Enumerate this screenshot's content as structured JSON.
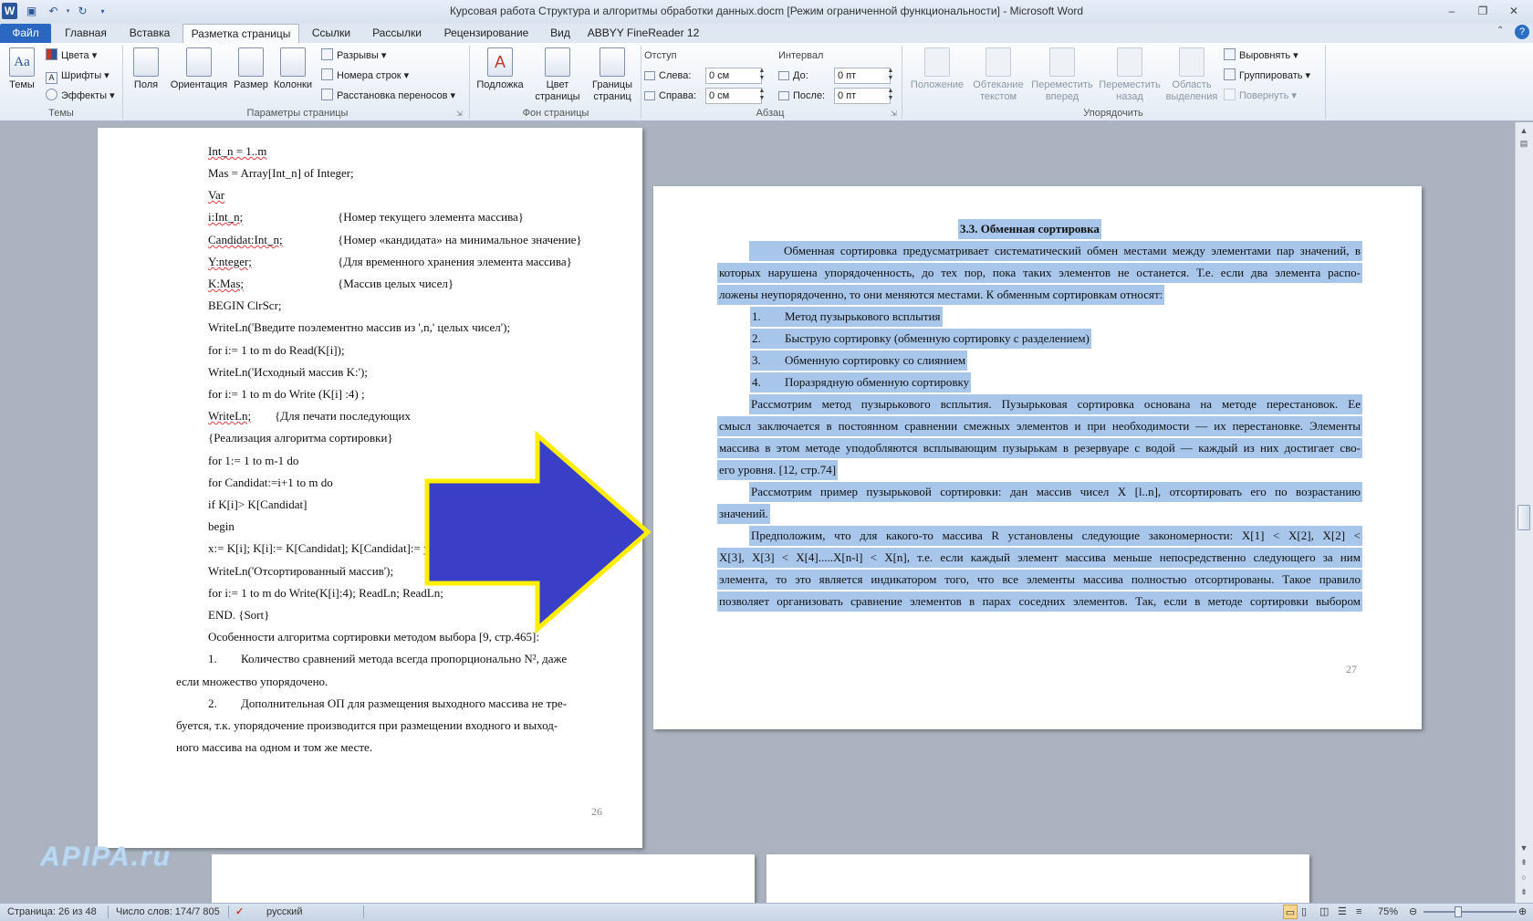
{
  "window": {
    "title": "Курсовая работа Структура и алгоритмы обработки данных.docm [Режим ограниченной функциональности] - Microsoft Word"
  },
  "tabs": [
    "Файл",
    "Главная",
    "Вставка",
    "Разметка страницы",
    "Ссылки",
    "Рассылки",
    "Рецензирование",
    "Вид",
    "ABBYY FineReader 12"
  ],
  "ribbon": {
    "themes": {
      "label": "Темы",
      "big": "Темы",
      "colors": "Цвета",
      "fonts": "Шрифты",
      "effects": "Эффекты"
    },
    "page_setup": {
      "label": "Параметры страницы",
      "fields": "Поля",
      "orientation": "Ориентация",
      "size": "Размер",
      "columns": "Колонки",
      "breaks": "Разрывы",
      "line_numbers": "Номера строк",
      "hyphenation": "Расстановка переносов"
    },
    "page_background": {
      "label": "Фон страницы",
      "watermark": "Подложка",
      "color_l1": "Цвет",
      "color_l2": "страницы",
      "borders_l1": "Границы",
      "borders_l2": "страниц"
    },
    "paragraph": {
      "label": "Абзац",
      "indent_title": "Отступ",
      "left_label": "Слева:",
      "left_value": "0 см",
      "right_label": "Справа:",
      "right_value": "0 см",
      "spacing_title": "Интервал",
      "before_label": "До:",
      "before_value": "0 пт",
      "after_label": "После:",
      "after_value": "0 пт"
    },
    "arrange": {
      "label": "Упорядочить",
      "position": "Положение",
      "wrap_l1": "Обтекание",
      "wrap_l2": "текстом",
      "forward_l1": "Переместить",
      "forward_l2": "вперед",
      "backward_l1": "Переместить",
      "backward_l2": "назад",
      "selection_l1": "Область",
      "selection_l2": "выделения",
      "align": "Выровнять",
      "group": "Группировать",
      "rotate": "Повернуть"
    }
  },
  "page26": {
    "lines": [
      "Int_n =   1..m",
      "Mas = Array[Int_n] of Integer;",
      "Var",
      "i:Int_n;",
      "{Номер текущего элемента массива}",
      "Candidat:Int_n;",
      "{Номер «кандидата» на минимальное значение}",
      "Y:nteger;",
      "{Для временного хранения элемента массива}",
      "K:Mas;",
      "{Массив целых чисел}",
      "BEGIN ClrScr;",
      "WriteLn('Введите поэлементно массив из ',n,' целых чисел');",
      "for i:= 1 to m do Read(K[i]);",
      "WriteLn('Исходный   массив   K:');",
      "for    i:=   1    to    m    do   Write (K[i] :4) ;",
      "WriteLn;",
      "{Для печати последующих",
      "{Реализация алгоритма сортировки}",
      "for 1:= 1 to m-1 do",
      "for Candidat:=i+1 to m do",
      "if K[i]> K[Candidat]",
      "begin",
      "x:= K[i];    K[i]:= K[Candidat]; K[Candidat]:= y; end:",
      "WriteLn('Отсортированный массив');",
      "for i:= 1 to m do Write(K[i]:4);  ReadLn; ReadLn;",
      "END.  {Sort}",
      "Особенности алгоритма сортировки методом выбора [9, стр.465]:",
      "1.",
      "Количество сравнений метода всегда пропорционально N², даже",
      "если множество упорядочено.",
      "2.",
      "Дополнительная ОП для размещения выходного массива не тре-",
      "буется, т.к. упорядочение  производится при размещении входного и выход-",
      "ного  массива на одном и том же месте."
    ],
    "page_number": "26"
  },
  "page27": {
    "heading": "3.3. Обменная сортировка",
    "lines": [
      "Обменная сортировка предусматривает систематический обмен местами между элементами пар значений, в",
      "которых нарушена упорядоченность, до тех пор, пока таких элементов не останется. Т.е. если два элемента распо-",
      "ложены неупорядоченно, то они меняются местами. К обменным сортировкам относят:",
      "1.",
      "Метод пузырькового всплытия",
      "2.",
      "Быструю сортировку (обменную сортировку с разделением)",
      "3.",
      "Обменную сортировку со слиянием",
      "4.",
      "Поразрядную обменную сортировку",
      "Рассмотрим метод пузырькового всплытия. Пузырьковая сортировка основана на методе перестановок. Ее",
      "смысл заключается в постоянном сравнении смежных элементов и при необходимости — их перестановке. Элементы",
      "массива в этом методе уподобляются всплывающим пузырькам в резервуаре с водой — каждый из них достигает сво-",
      "его уровня. [12, стр.74]",
      "Рассмотрим пример пузырьковой сортировки: дан массив чисел X [l..n], отсортировать его по возрастанию",
      "значений.",
      "Предположим, что для какого-то массива R установлены следующие закономерности: X[1] < X[2], X[2] <",
      "X[3], X[3] < X[4].....X[n-l] < X[n], т.е. если каждый элемент массива меньше непосредственно следующего за ним",
      "элемента, то это является индикатором того, что все элементы массива полностью отсортированы. Такое правило",
      "позволяет организовать сравнение элементов в парах соседних элементов. Так, если в методе сортировки выбором"
    ],
    "page_number": "27"
  },
  "status": {
    "page": "Страница: 26 из 48",
    "words": "Число слов: 174/7 805",
    "language": "русский",
    "zoom": "75%"
  },
  "watermark": "APIPA.ru",
  "colors": {
    "selection": "#a8c5ea",
    "arrow_fill": "#3a3fc8",
    "arrow_stroke": "#ffee00",
    "file_tab": "#2a67c0"
  }
}
